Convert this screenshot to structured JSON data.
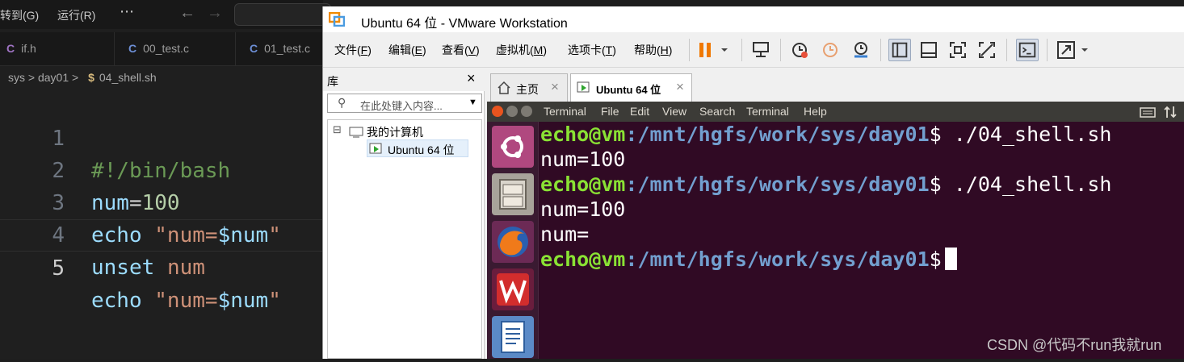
{
  "vscode": {
    "menu": [
      "转到(G)",
      "运行(R)",
      "⋯"
    ],
    "tabs": [
      "if.h",
      "00_test.c",
      "01_test.c"
    ],
    "tab_icon": "C",
    "breadcrumb": [
      "sys",
      "day01",
      "04_shell.sh"
    ],
    "breadcrumb_sep": ">",
    "file_icon": "$",
    "line_numbers": [
      "1",
      "2",
      "3",
      "4",
      "5"
    ],
    "code": {
      "l1": "#!/bin/bash",
      "l2_var": "num",
      "l2_eq": "=",
      "l2_val": "100",
      "l3_cmd": "echo",
      "l3_q1": "\"num=",
      "l3_ref": "$num",
      "l3_q2": "\"",
      "l4_cmd": "unset",
      "l4_arg": "num",
      "l5_cmd": "echo",
      "l5_q1": "\"num=",
      "l5_ref": "$num",
      "l5_q2": "\""
    }
  },
  "vmware": {
    "title": "Ubuntu 64 位 - VMware Workstation",
    "menu": [
      {
        "pre": "文件(",
        "key": "F",
        "post": ")"
      },
      {
        "pre": "编辑(",
        "key": "E",
        "post": ")"
      },
      {
        "pre": "查看(",
        "key": "V",
        "post": ")"
      },
      {
        "pre": "虚拟机(",
        "key": "M",
        "post": ")"
      },
      {
        "pre": "选项卡(",
        "key": "T",
        "post": ")"
      },
      {
        "pre": "帮助(",
        "key": "H",
        "post": ")"
      }
    ],
    "library": {
      "title": "库",
      "close": "×",
      "search_placeholder": "在此处键入内容...",
      "tree_root": "我的计算机",
      "tree_child": "Ubuntu 64 位",
      "expander": "⊟"
    },
    "tabs": [
      {
        "label": "主页",
        "close": "×"
      },
      {
        "label": "Ubuntu 64 位",
        "close": "×"
      }
    ],
    "terminal": {
      "menu": [
        "Terminal",
        "File",
        "Edit",
        "View",
        "Search",
        "Terminal",
        "Help"
      ],
      "lines": [
        {
          "user": "echo@vm",
          "path": ":/mnt/hgfs/work/sys/day01",
          "dollar": "$",
          "cmd": " ./04_shell.sh"
        },
        {
          "text": "num=100"
        },
        {
          "user": "echo@vm",
          "path": ":/mnt/hgfs/work/sys/day01",
          "dollar": "$",
          "cmd": " ./04_shell.sh"
        },
        {
          "text": "num=100"
        },
        {
          "text": "num="
        },
        {
          "user": "echo@vm",
          "path": ":/mnt/hgfs/work/sys/day01",
          "dollar": "$",
          "cmd": ""
        }
      ]
    }
  },
  "watermark": "CSDN @代码不run我就run",
  "colors": {
    "term_bg": "#300a24",
    "prompt_user": "#8ae234",
    "prompt_path": "#729fcf",
    "vscode_bg": "#1f1f1f"
  }
}
